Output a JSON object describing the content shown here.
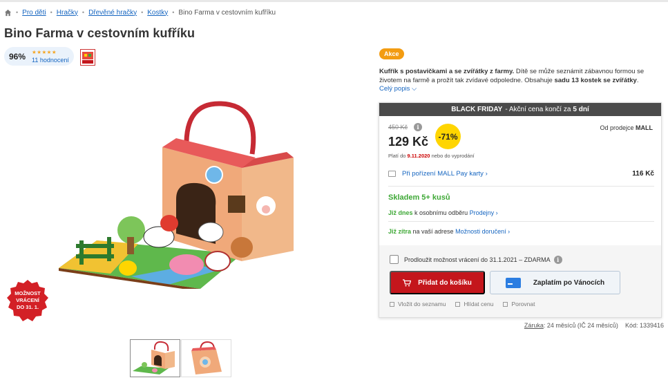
{
  "breadcrumb": {
    "items": [
      "Pro děti",
      "Hračky",
      "Dřevěné hračky",
      "Kostky"
    ],
    "current": "Bino Farma v cestovním kufříku"
  },
  "product": {
    "title": "Bino Farma v cestovním kufříku",
    "rating_percent": "96%",
    "stars": "★★★★★",
    "rating_count": "11 hodnocení",
    "brand_logo_icon": "bino-logo-icon",
    "return_badge": [
      "MOŽNOST",
      "VRÁCENÍ",
      "DO 31. 1."
    ]
  },
  "offer": {
    "tag": "Akce",
    "description_bold": "Kufřík s postavičkami a se zvířátky z farmy.",
    "description_1": " Dítě se může seznámit zábavnou formou se životem na farmě a prožít tak zvídavé odpoledne. Obsahuje ",
    "description_bold2": "sadu 13 kostek se zvířátky",
    "description_2": ".",
    "description_link": "Celý popis",
    "bf_bold": "BLACK FRIDAY",
    "bf_text": " - Akční cena končí za",
    "bf_days": "5 dní",
    "old_price": "450 Kč",
    "price": "129 Kč",
    "discount": "-71%",
    "valid_prefix": "Platí do",
    "valid_date": "9.11.2020",
    "valid_suffix": "nebo do vyprodání",
    "seller_prefix": "Od prodejce",
    "seller": "MALL",
    "mallpay_link": "Při pořízení MALL Pay karty",
    "mallpay_amount": "116 Kč",
    "stock": "Skladem 5+ kusů",
    "pickup_bold": "Již dnes",
    "pickup_text": "k osobnímu odběru",
    "pickup_link": "Prodejny",
    "delivery_bold": "Již zítra",
    "delivery_text": "na vaší adrese",
    "delivery_link": "Možnosti doručení",
    "extend_return": "Prodloužit možnost vrácení do 31.1.2021 – ZDARMA",
    "add_to_cart": "Přidat do košíku",
    "pay_later": "Zaplatím po Vánocích",
    "wishlist": "Vložit do seznamu",
    "watch_price": "Hlídat cenu",
    "compare": "Porovnat",
    "warranty_label": "Záruka",
    "warranty_text": ": 24 měsíců (IČ 24 měsíců)",
    "code": "Kód: 1339416"
  },
  "colors": {
    "accent_red": "#c4161c",
    "link_blue": "#1565c0",
    "stock_green": "#3ea836",
    "akce_orange": "#f39c12",
    "discount_yellow": "#ffd500"
  }
}
